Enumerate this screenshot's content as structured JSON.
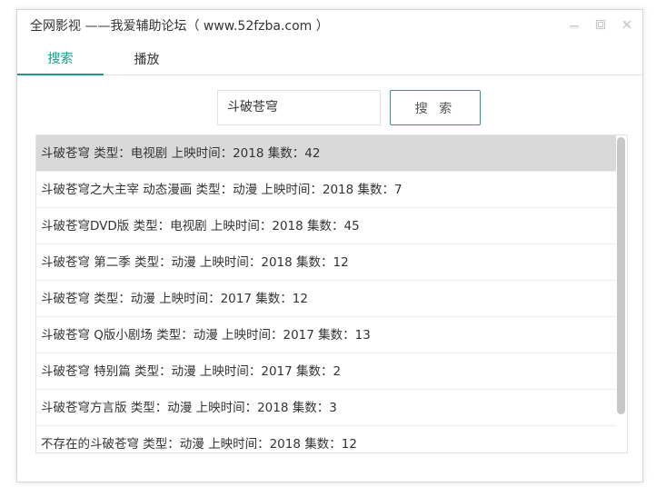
{
  "window": {
    "title": "全网影视 ——我爱辅助论坛（ www.52fzba.com ）"
  },
  "tabs": [
    {
      "label": "搜索",
      "active": true
    },
    {
      "label": "播放",
      "active": false
    }
  ],
  "search": {
    "value": "斗破苍穹",
    "button_label": "搜 索"
  },
  "results": [
    {
      "text": "斗破苍穹 类型：电视剧 上映时间：2018 集数：42",
      "selected": true
    },
    {
      "text": "斗破苍穹之大主宰 动态漫画 类型：动漫 上映时间：2018 集数：7"
    },
    {
      "text": "斗破苍穹DVD版 类型：电视剧 上映时间：2018 集数：45"
    },
    {
      "text": "斗破苍穹 第二季 类型：动漫 上映时间：2018 集数：12"
    },
    {
      "text": "斗破苍穹 类型：动漫 上映时间：2017 集数：12"
    },
    {
      "text": "斗破苍穹 Q版小剧场 类型：动漫 上映时间：2017 集数：13"
    },
    {
      "text": "斗破苍穹 特别篇 类型：动漫 上映时间：2017 集数：2"
    },
    {
      "text": "斗破苍穹方言版 类型：动漫 上映时间：2018 集数：3"
    },
    {
      "text": "不存在的斗破苍穹 类型：动漫 上映时间：2018 集数：12"
    }
  ],
  "colors": {
    "accent": "#1a9c8a",
    "selected_row": "#d9d9d9"
  },
  "icons": [
    "minimize-icon",
    "maximize-icon",
    "close-icon"
  ]
}
